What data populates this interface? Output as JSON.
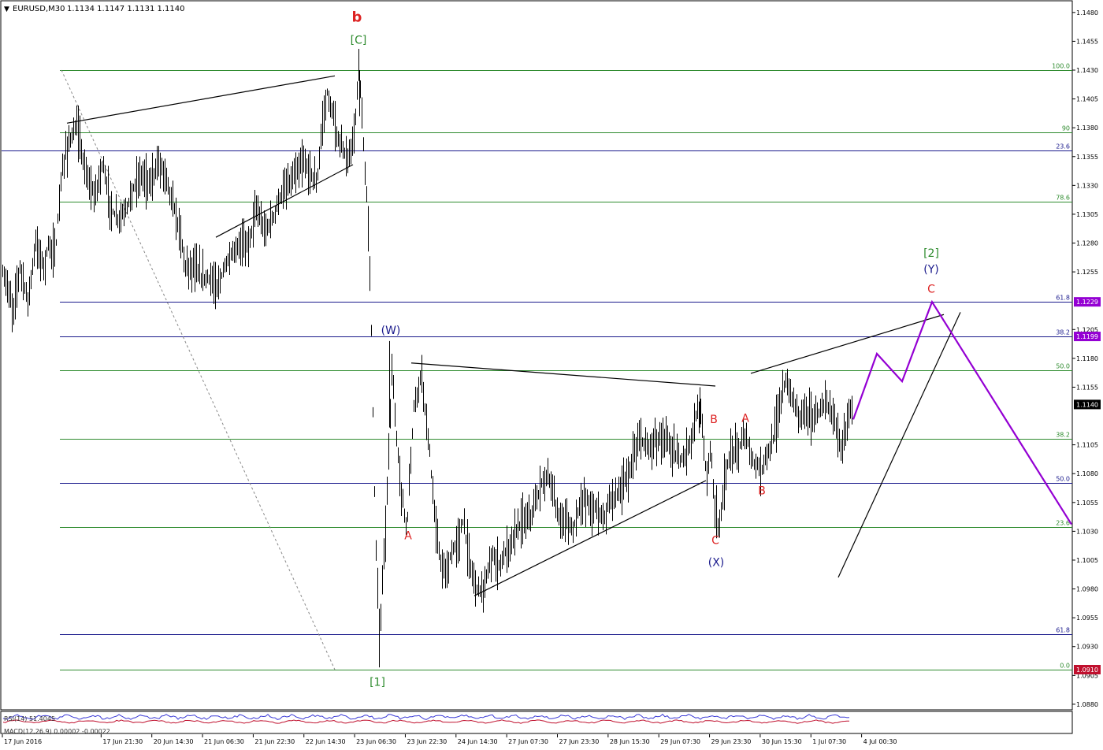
{
  "header": {
    "symbol": "EURUSD,M30",
    "ohlc": "1.1134 1.1147 1.1131 1.1140"
  },
  "indicators": {
    "rsi_label": "RSI(14) 51.4045",
    "macd_label": "MACD(12,26,9) 0.00002 -0.00022"
  },
  "colors": {
    "background": "#ffffff",
    "bars": "#000000",
    "fib_green": "#2e8b2e",
    "fib_blue": "#1a1a8c",
    "wave_red": "#dd2222",
    "wave_green": "#2e8b2e",
    "wave_blue": "#1a1a8c",
    "projection": "#9400d3",
    "price_tag": "#000000",
    "current_tag_bg": "#000000",
    "level_tag_purple": "#9400d3",
    "level_tag_red": "#c0102e"
  },
  "chart_data": {
    "type": "candlestick",
    "title": "EURUSD,M30",
    "symbol": "EURUSD",
    "timeframe": "M30",
    "last_ohlc": {
      "open": 1.1134,
      "high": 1.1147,
      "low": 1.1131,
      "close": 1.114
    },
    "y_ticks": [
      "1.1480",
      "1.1455",
      "1.1430",
      "1.1405",
      "1.1380",
      "1.1355",
      "1.1330",
      "1.1305",
      "1.1280",
      "1.1255",
      "1.1205",
      "1.1180",
      "1.1155",
      "1.1105",
      "1.1080",
      "1.1055",
      "1.1030",
      "1.1005",
      "1.0980",
      "1.0955",
      "1.0930",
      "1.0905",
      "1.0880"
    ],
    "ylim": [
      1.0875,
      1.1487
    ],
    "x_ticks": [
      "17 Jun 2016",
      "17 Jun 21:30",
      "20 Jun 14:30",
      "21 Jun 06:30",
      "21 Jun 22:30",
      "22 Jun 14:30",
      "23 Jun 06:30",
      "23 Jun 22:30",
      "24 Jun 14:30",
      "27 Jun 07:30",
      "27 Jun 23:30",
      "28 Jun 15:30",
      "29 Jun 07:30",
      "29 Jun 23:30",
      "30 Jun 15:30",
      "1 Jul 07:30",
      "4 Jul 00:30"
    ],
    "price_path": [
      [
        0,
        1.126
      ],
      [
        10,
        1.124
      ],
      [
        16,
        1.122
      ],
      [
        25,
        1.126
      ],
      [
        35,
        1.123
      ],
      [
        45,
        1.128
      ],
      [
        55,
        1.126
      ],
      [
        62,
        1.128
      ],
      [
        70,
        1.127
      ],
      [
        74,
        1.131
      ],
      [
        80,
        1.135
      ],
      [
        88,
        1.137
      ],
      [
        98,
        1.138
      ],
      [
        108,
        1.134
      ],
      [
        120,
        1.132
      ],
      [
        130,
        1.135
      ],
      [
        140,
        1.131
      ],
      [
        150,
        1.13
      ],
      [
        160,
        1.131
      ],
      [
        170,
        1.133
      ],
      [
        180,
        1.134
      ],
      [
        190,
        1.133
      ],
      [
        200,
        1.135
      ],
      [
        210,
        1.134
      ],
      [
        220,
        1.131
      ],
      [
        228,
        1.129
      ],
      [
        235,
        1.126
      ],
      [
        245,
        1.126
      ],
      [
        255,
        1.125
      ],
      [
        265,
        1.125
      ],
      [
        275,
        1.124
      ],
      [
        285,
        1.126
      ],
      [
        295,
        1.127
      ],
      [
        305,
        1.128
      ],
      [
        315,
        1.128
      ],
      [
        325,
        1.131
      ],
      [
        335,
        1.129
      ],
      [
        345,
        1.13
      ],
      [
        355,
        1.132
      ],
      [
        365,
        1.133
      ],
      [
        375,
        1.134
      ],
      [
        385,
        1.135
      ],
      [
        395,
        1.134
      ],
      [
        402,
        1.133
      ],
      [
        408,
        1.138
      ],
      [
        415,
        1.141
      ],
      [
        422,
        1.139
      ],
      [
        428,
        1.137
      ],
      [
        436,
        1.136
      ],
      [
        442,
        1.135
      ],
      [
        450,
        1.138
      ],
      [
        455,
        1.143
      ],
      [
        460,
        1.138
      ],
      [
        466,
        1.131
      ],
      [
        470,
        1.124
      ],
      [
        472,
        1.117
      ],
      [
        474,
        1.11
      ],
      [
        476,
        1.103
      ],
      [
        479,
        1.098
      ],
      [
        482,
        1.094
      ],
      [
        485,
        1.099
      ],
      [
        489,
        1.103
      ],
      [
        493,
        1.11
      ],
      [
        497,
        1.117
      ],
      [
        502,
        1.112
      ],
      [
        508,
        1.107
      ],
      [
        512,
        1.105
      ],
      [
        516,
        1.103
      ],
      [
        520,
        1.108
      ],
      [
        525,
        1.114
      ],
      [
        530,
        1.115
      ],
      [
        535,
        1.117
      ],
      [
        540,
        1.113
      ],
      [
        545,
        1.11
      ],
      [
        550,
        1.105
      ],
      [
        555,
        1.102
      ],
      [
        560,
        1.1
      ],
      [
        566,
        1.099
      ],
      [
        572,
        1.101
      ],
      [
        580,
        1.102
      ],
      [
        588,
        1.104
      ],
      [
        594,
        1.101
      ],
      [
        600,
        1.099
      ],
      [
        606,
        1.098
      ],
      [
        612,
        1.098
      ],
      [
        618,
        1.099
      ],
      [
        625,
        1.101
      ],
      [
        632,
        1.1
      ],
      [
        640,
        1.101
      ],
      [
        648,
        1.102
      ],
      [
        655,
        1.103
      ],
      [
        662,
        1.104
      ],
      [
        670,
        1.104
      ],
      [
        678,
        1.105
      ],
      [
        686,
        1.107
      ],
      [
        694,
        1.108
      ],
      [
        702,
        1.106
      ],
      [
        710,
        1.104
      ],
      [
        718,
        1.104
      ],
      [
        726,
        1.103
      ],
      [
        734,
        1.105
      ],
      [
        742,
        1.106
      ],
      [
        750,
        1.105
      ],
      [
        758,
        1.105
      ],
      [
        766,
        1.104
      ],
      [
        774,
        1.106
      ],
      [
        782,
        1.106
      ],
      [
        790,
        1.107
      ],
      [
        798,
        1.108
      ],
      [
        806,
        1.11
      ],
      [
        814,
        1.111
      ],
      [
        822,
        1.11
      ],
      [
        830,
        1.111
      ],
      [
        838,
        1.111
      ],
      [
        846,
        1.111
      ],
      [
        854,
        1.11
      ],
      [
        862,
        1.109
      ],
      [
        870,
        1.11
      ],
      [
        878,
        1.111
      ],
      [
        886,
        1.114
      ],
      [
        891,
        1.112
      ],
      [
        896,
        1.108
      ],
      [
        902,
        1.11
      ],
      [
        906,
        1.106
      ],
      [
        910,
        1.103
      ],
      [
        914,
        1.104
      ],
      [
        918,
        1.107
      ],
      [
        924,
        1.109
      ],
      [
        930,
        1.11
      ],
      [
        936,
        1.11
      ],
      [
        942,
        1.111
      ],
      [
        948,
        1.111
      ],
      [
        954,
        1.109
      ],
      [
        960,
        1.109
      ],
      [
        966,
        1.108
      ],
      [
        972,
        1.11
      ],
      [
        978,
        1.11
      ],
      [
        984,
        1.112
      ],
      [
        990,
        1.114
      ],
      [
        996,
        1.116
      ],
      [
        1002,
        1.115
      ],
      [
        1008,
        1.114
      ],
      [
        1014,
        1.113
      ],
      [
        1020,
        1.114
      ],
      [
        1026,
        1.113
      ],
      [
        1032,
        1.113
      ],
      [
        1038,
        1.113
      ],
      [
        1044,
        1.114
      ],
      [
        1050,
        1.114
      ],
      [
        1056,
        1.113
      ],
      [
        1062,
        1.112
      ],
      [
        1068,
        1.11
      ],
      [
        1074,
        1.112
      ],
      [
        1080,
        1.114
      ]
    ],
    "fib_levels": [
      {
        "label": "100.0",
        "price": 1.143,
        "color": "green"
      },
      {
        "label": "90",
        "price": 1.1376,
        "color": "green"
      },
      {
        "label": "23.6",
        "price": 1.136,
        "color": "blue"
      },
      {
        "label": "78.6",
        "price": 1.1316,
        "color": "green"
      },
      {
        "label": "61.8",
        "price": 1.1229,
        "color": "blue"
      },
      {
        "label": "38.2",
        "price": 1.1199,
        "color": "blue"
      },
      {
        "label": "50.0",
        "price": 1.117,
        "color": "green"
      },
      {
        "label": "38.2",
        "price": 1.111,
        "color": "green"
      },
      {
        "label": "50.0",
        "price": 1.1072,
        "color": "blue"
      },
      {
        "label": "23.6",
        "price": 1.1034,
        "color": "green"
      },
      {
        "label": "61.8",
        "price": 1.0941,
        "color": "blue"
      },
      {
        "label": "0.0",
        "price": 1.091,
        "color": "green"
      }
    ],
    "price_tags": [
      {
        "label": "1.1229",
        "price": 1.1229,
        "style": "purple"
      },
      {
        "label": "1.1199",
        "price": 1.1199,
        "style": "purple"
      },
      {
        "label": "1.1140",
        "price": 1.114,
        "style": "current"
      },
      {
        "label": "1.0910",
        "price": 1.091,
        "style": "red"
      }
    ],
    "wave_labels": [
      {
        "text": "b",
        "x": 17,
        "price": 1.1472,
        "color": "red",
        "bold": true
      },
      {
        "text": "[C]",
        "x": 17,
        "price": 1.1453,
        "color": "green"
      },
      {
        "text": "[1]",
        "x": 23,
        "price": 1.0896,
        "color": "green"
      },
      {
        "text": "(W)",
        "x": 24,
        "price": 1.1201,
        "color": "blue"
      },
      {
        "text": "A",
        "x": 24.1,
        "price": 1.1023,
        "color": "red"
      },
      {
        "text": "B",
        "x": 30.15,
        "price": 1.1124,
        "color": "red"
      },
      {
        "text": "C",
        "x": 30.3,
        "price": 1.1019,
        "color": "red"
      },
      {
        "text": "(X)",
        "x": 30.3,
        "price": 1.1,
        "color": "blue"
      },
      {
        "text": "A",
        "x": 31.45,
        "price": 1.1125,
        "color": "red"
      },
      {
        "text": "B",
        "x": 31.8,
        "price": 1.1062,
        "color": "red"
      },
      {
        "text": "[2]",
        "x": 34.5,
        "price": 1.1268,
        "color": "green"
      },
      {
        "text": "(Y)",
        "x": 34.5,
        "price": 1.1254,
        "color": "blue"
      },
      {
        "text": "C",
        "x": 34.5,
        "price": 1.1237,
        "color": "red"
      }
    ],
    "trendlines": [
      {
        "from": [
          1.5,
          1.1384
        ],
        "to": [
          16.2,
          1.1425
        ]
      },
      {
        "from": [
          14.9,
          1.1285
        ],
        "to": [
          21.6,
          1.1348
        ]
      },
      {
        "from": [
          23.5,
          1.1176
        ],
        "to": [
          29.2,
          1.1156
        ]
      },
      {
        "from": [
          26.9,
          1.0974
        ],
        "to": [
          29.7,
          1.1074
        ]
      },
      {
        "from": [
          33.0,
          1.1167
        ],
        "to": [
          35.2,
          1.1218
        ]
      },
      {
        "from": [
          33.8,
          1.099
        ],
        "to": [
          35.4,
          1.122
        ]
      }
    ],
    "projection_path": [
      [
        1.1127
      ],
      [
        1.1184
      ],
      [
        1.116
      ],
      [
        1.1229
      ],
      [
        1.1036
      ]
    ],
    "grid": false
  }
}
